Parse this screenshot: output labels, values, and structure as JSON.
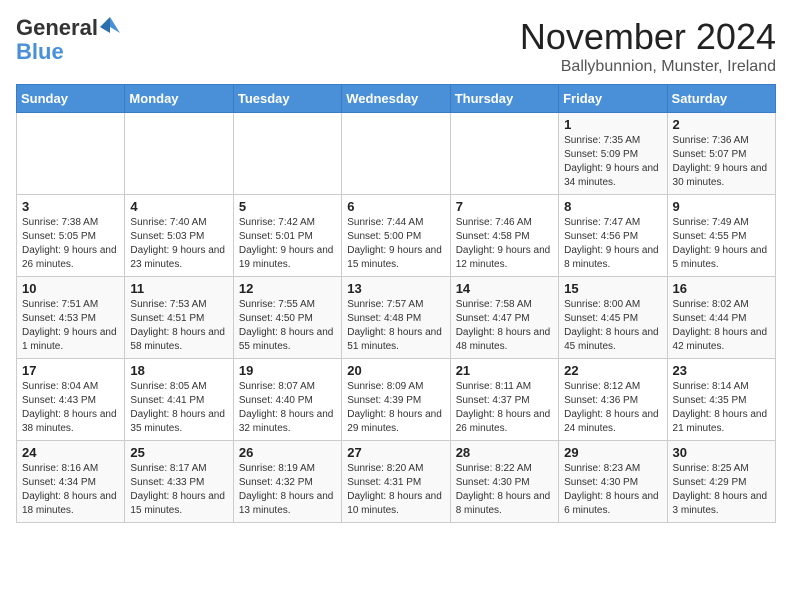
{
  "logo": {
    "general": "General",
    "blue": "Blue"
  },
  "title": "November 2024",
  "location": "Ballybunnion, Munster, Ireland",
  "days_of_week": [
    "Sunday",
    "Monday",
    "Tuesday",
    "Wednesday",
    "Thursday",
    "Friday",
    "Saturday"
  ],
  "weeks": [
    [
      {
        "day": "",
        "info": ""
      },
      {
        "day": "",
        "info": ""
      },
      {
        "day": "",
        "info": ""
      },
      {
        "day": "",
        "info": ""
      },
      {
        "day": "",
        "info": ""
      },
      {
        "day": "1",
        "info": "Sunrise: 7:35 AM\nSunset: 5:09 PM\nDaylight: 9 hours and 34 minutes."
      },
      {
        "day": "2",
        "info": "Sunrise: 7:36 AM\nSunset: 5:07 PM\nDaylight: 9 hours and 30 minutes."
      }
    ],
    [
      {
        "day": "3",
        "info": "Sunrise: 7:38 AM\nSunset: 5:05 PM\nDaylight: 9 hours and 26 minutes."
      },
      {
        "day": "4",
        "info": "Sunrise: 7:40 AM\nSunset: 5:03 PM\nDaylight: 9 hours and 23 minutes."
      },
      {
        "day": "5",
        "info": "Sunrise: 7:42 AM\nSunset: 5:01 PM\nDaylight: 9 hours and 19 minutes."
      },
      {
        "day": "6",
        "info": "Sunrise: 7:44 AM\nSunset: 5:00 PM\nDaylight: 9 hours and 15 minutes."
      },
      {
        "day": "7",
        "info": "Sunrise: 7:46 AM\nSunset: 4:58 PM\nDaylight: 9 hours and 12 minutes."
      },
      {
        "day": "8",
        "info": "Sunrise: 7:47 AM\nSunset: 4:56 PM\nDaylight: 9 hours and 8 minutes."
      },
      {
        "day": "9",
        "info": "Sunrise: 7:49 AM\nSunset: 4:55 PM\nDaylight: 9 hours and 5 minutes."
      }
    ],
    [
      {
        "day": "10",
        "info": "Sunrise: 7:51 AM\nSunset: 4:53 PM\nDaylight: 9 hours and 1 minute."
      },
      {
        "day": "11",
        "info": "Sunrise: 7:53 AM\nSunset: 4:51 PM\nDaylight: 8 hours and 58 minutes."
      },
      {
        "day": "12",
        "info": "Sunrise: 7:55 AM\nSunset: 4:50 PM\nDaylight: 8 hours and 55 minutes."
      },
      {
        "day": "13",
        "info": "Sunrise: 7:57 AM\nSunset: 4:48 PM\nDaylight: 8 hours and 51 minutes."
      },
      {
        "day": "14",
        "info": "Sunrise: 7:58 AM\nSunset: 4:47 PM\nDaylight: 8 hours and 48 minutes."
      },
      {
        "day": "15",
        "info": "Sunrise: 8:00 AM\nSunset: 4:45 PM\nDaylight: 8 hours and 45 minutes."
      },
      {
        "day": "16",
        "info": "Sunrise: 8:02 AM\nSunset: 4:44 PM\nDaylight: 8 hours and 42 minutes."
      }
    ],
    [
      {
        "day": "17",
        "info": "Sunrise: 8:04 AM\nSunset: 4:43 PM\nDaylight: 8 hours and 38 minutes."
      },
      {
        "day": "18",
        "info": "Sunrise: 8:05 AM\nSunset: 4:41 PM\nDaylight: 8 hours and 35 minutes."
      },
      {
        "day": "19",
        "info": "Sunrise: 8:07 AM\nSunset: 4:40 PM\nDaylight: 8 hours and 32 minutes."
      },
      {
        "day": "20",
        "info": "Sunrise: 8:09 AM\nSunset: 4:39 PM\nDaylight: 8 hours and 29 minutes."
      },
      {
        "day": "21",
        "info": "Sunrise: 8:11 AM\nSunset: 4:37 PM\nDaylight: 8 hours and 26 minutes."
      },
      {
        "day": "22",
        "info": "Sunrise: 8:12 AM\nSunset: 4:36 PM\nDaylight: 8 hours and 24 minutes."
      },
      {
        "day": "23",
        "info": "Sunrise: 8:14 AM\nSunset: 4:35 PM\nDaylight: 8 hours and 21 minutes."
      }
    ],
    [
      {
        "day": "24",
        "info": "Sunrise: 8:16 AM\nSunset: 4:34 PM\nDaylight: 8 hours and 18 minutes."
      },
      {
        "day": "25",
        "info": "Sunrise: 8:17 AM\nSunset: 4:33 PM\nDaylight: 8 hours and 15 minutes."
      },
      {
        "day": "26",
        "info": "Sunrise: 8:19 AM\nSunset: 4:32 PM\nDaylight: 8 hours and 13 minutes."
      },
      {
        "day": "27",
        "info": "Sunrise: 8:20 AM\nSunset: 4:31 PM\nDaylight: 8 hours and 10 minutes."
      },
      {
        "day": "28",
        "info": "Sunrise: 8:22 AM\nSunset: 4:30 PM\nDaylight: 8 hours and 8 minutes."
      },
      {
        "day": "29",
        "info": "Sunrise: 8:23 AM\nSunset: 4:30 PM\nDaylight: 8 hours and 6 minutes."
      },
      {
        "day": "30",
        "info": "Sunrise: 8:25 AM\nSunset: 4:29 PM\nDaylight: 8 hours and 3 minutes."
      }
    ]
  ]
}
